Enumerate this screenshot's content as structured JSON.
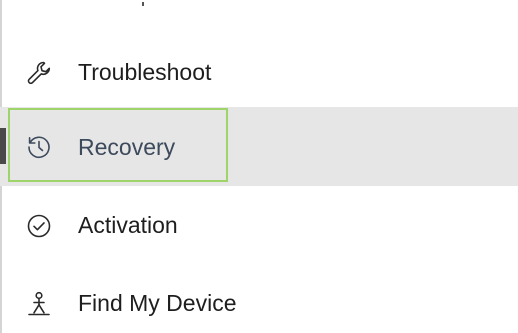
{
  "nav": {
    "items": [
      {
        "label": "Troubleshoot",
        "icon": "wrench-icon",
        "selected": false
      },
      {
        "label": "Recovery",
        "icon": "history-clock-icon",
        "selected": true
      },
      {
        "label": "Activation",
        "icon": "check-circle-icon",
        "selected": false
      },
      {
        "label": "Find My Device",
        "icon": "person-location-icon",
        "selected": false
      }
    ]
  },
  "colors": {
    "background": "#ffffff",
    "selected_background": "#e6e6e6",
    "selection_indicator": "#4a4a4a",
    "focus_outline": "#9fd46a",
    "text": "#1e1e1e",
    "selected_text": "#3d4a5c"
  }
}
